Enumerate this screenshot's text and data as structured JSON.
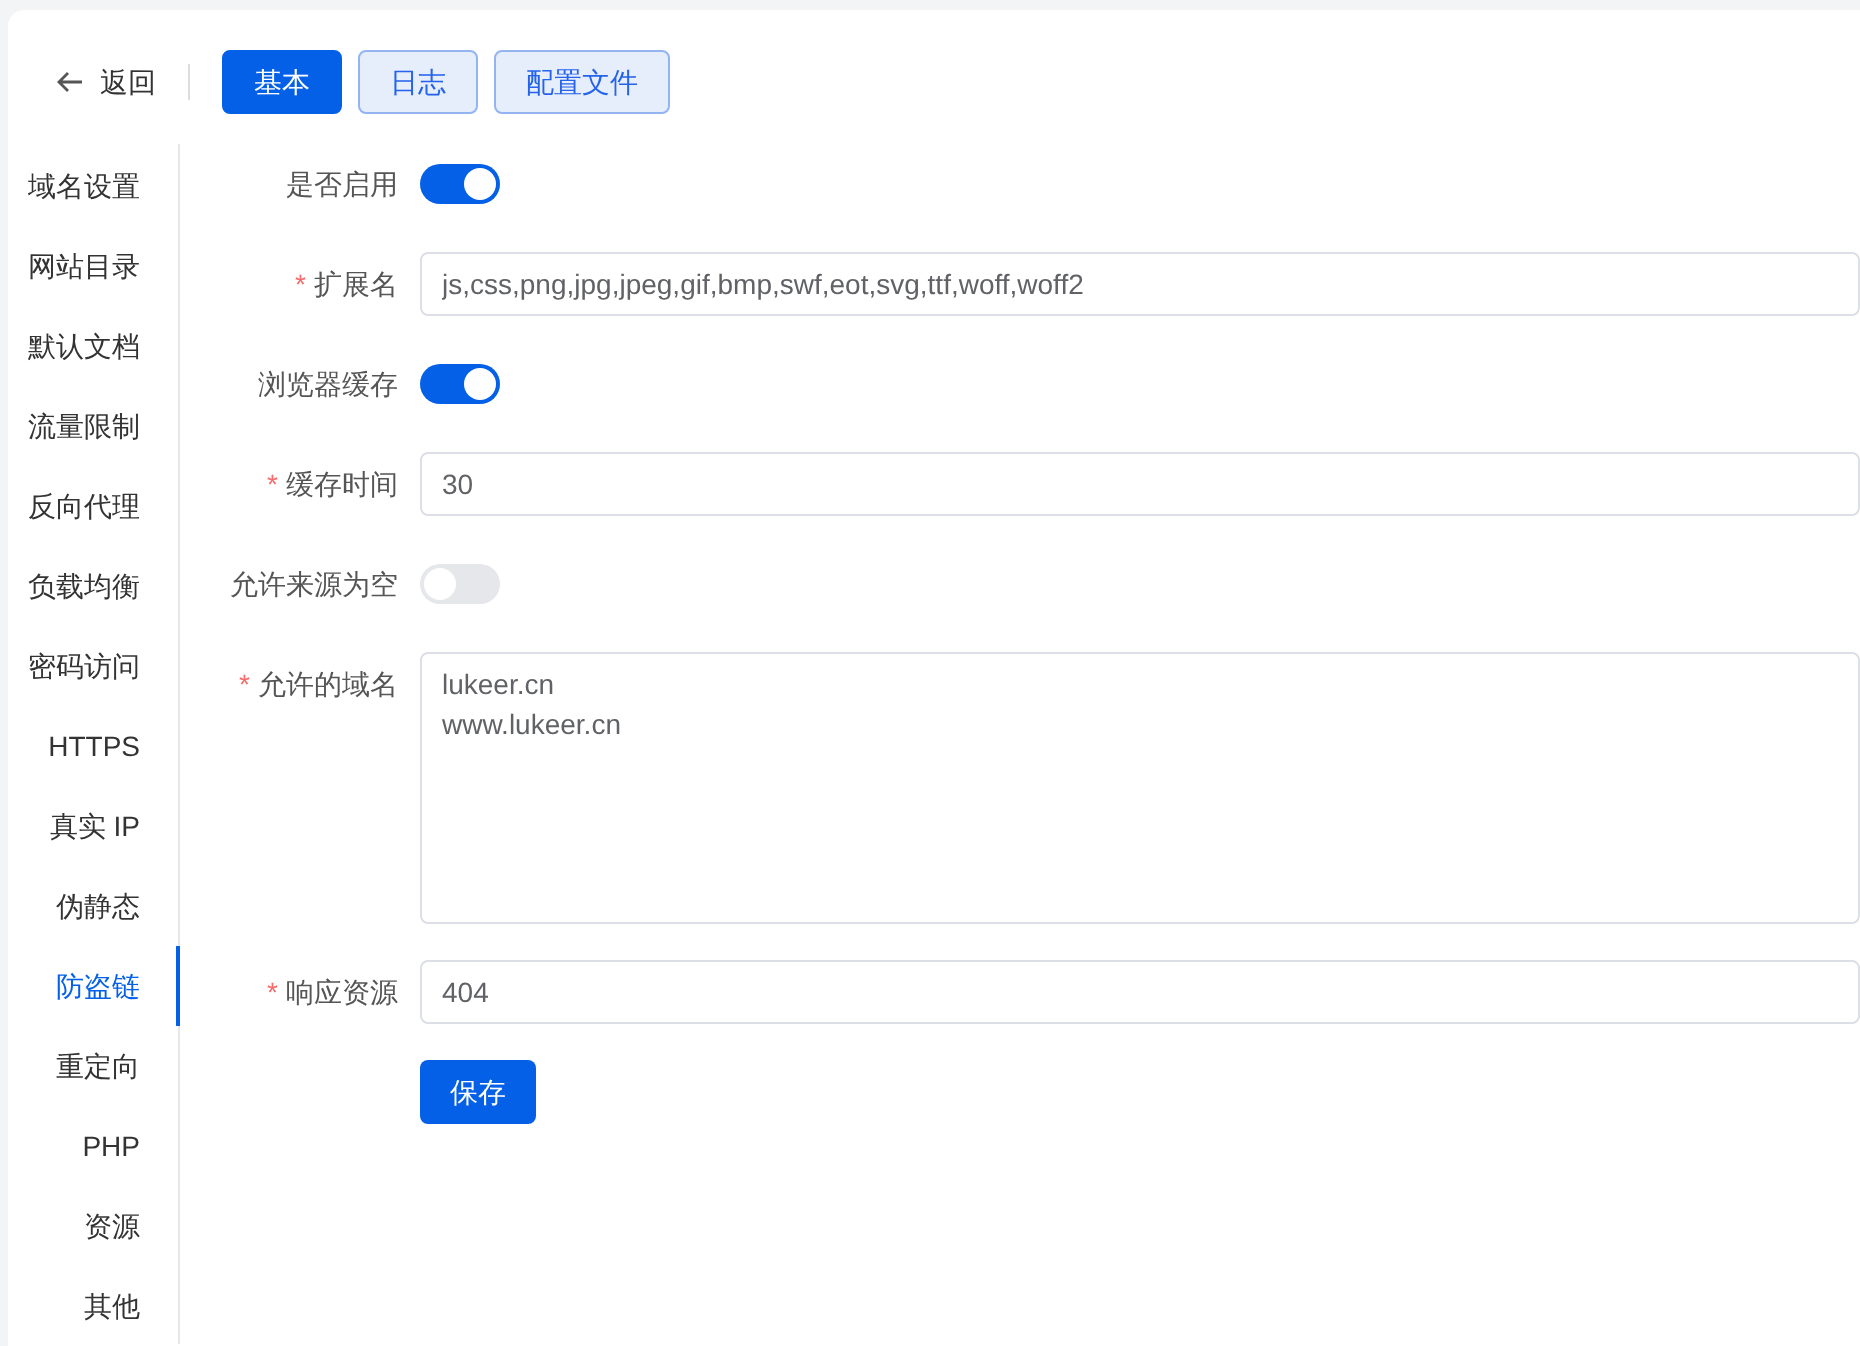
{
  "header": {
    "back_label": "返回",
    "tabs": [
      {
        "label": "基本",
        "selected": true
      },
      {
        "label": "日志",
        "selected": false
      },
      {
        "label": "配置文件",
        "selected": false
      }
    ]
  },
  "sidebar": {
    "items": [
      {
        "label": "域名设置",
        "selected": false
      },
      {
        "label": "网站目录",
        "selected": false
      },
      {
        "label": "默认文档",
        "selected": false
      },
      {
        "label": "流量限制",
        "selected": false
      },
      {
        "label": "反向代理",
        "selected": false
      },
      {
        "label": "负载均衡",
        "selected": false
      },
      {
        "label": "密码访问",
        "selected": false
      },
      {
        "label": "HTTPS",
        "selected": false
      },
      {
        "label": "真实 IP",
        "selected": false
      },
      {
        "label": "伪静态",
        "selected": false
      },
      {
        "label": "防盗链",
        "selected": true
      },
      {
        "label": "重定向",
        "selected": false
      },
      {
        "label": "PHP",
        "selected": false
      },
      {
        "label": "资源",
        "selected": false
      },
      {
        "label": "其他",
        "selected": false
      }
    ]
  },
  "form": {
    "fields": [
      {
        "kind": "switch",
        "label": "是否启用",
        "on": true
      },
      {
        "kind": "input",
        "label": "扩展名",
        "required_mark": "*",
        "value": "js,css,png,jpg,jpeg,gif,bmp,swf,eot,svg,ttf,woff,woff2"
      },
      {
        "kind": "switch",
        "label": "浏览器缓存",
        "on": true
      },
      {
        "kind": "input",
        "label": "缓存时间",
        "required_mark": "*",
        "value": "30"
      },
      {
        "kind": "switch",
        "label": "允许来源为空",
        "on": false
      },
      {
        "kind": "textarea",
        "label": "允许的域名",
        "required_mark": "*",
        "value": "lukeer.cn\nwww.lukeer.cn"
      },
      {
        "kind": "input",
        "label": "响应资源",
        "required_mark": "*",
        "value": "404"
      }
    ],
    "submit_label": "保存"
  }
}
